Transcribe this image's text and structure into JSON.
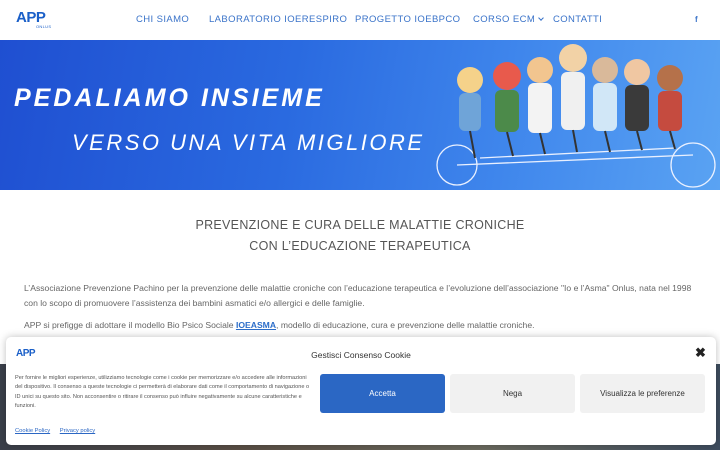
{
  "header": {
    "logo_text": "APP",
    "logo_sub": "ONLUS",
    "nav": [
      {
        "label": "CHI SIAMO"
      },
      {
        "label": "LABORATORIO IOERESPIRO"
      },
      {
        "label": "PROGETTO IOEBPCO"
      },
      {
        "label": "CORSO ECM"
      },
      {
        "label": "CONTATTI"
      }
    ],
    "social_icon": "facebook-icon",
    "social_glyph": "f"
  },
  "banner": {
    "line1": "PEDALIAMO INSIEME",
    "line2": "VERSO UNA VITA MIGLIORE"
  },
  "main": {
    "headline1": "PREVENZIONE E CURA DELLE MALATTIE CRONICHE",
    "headline2": "CON L’EDUCAZIONE TERAPEUTICA",
    "para1": "L’Associazione Prevenzione Pachino per la prevenzione delle malattie croniche con l’educazione terapeutica e l’evoluzione dell’associazione \"Io e l’Asma\" Onlus, nata nel 1998 con lo scopo di promuovere l’assistenza dei bambini asmatici e/o allergici e delle famiglie.",
    "para2_before": "APP si prefigge di adottare il modello Bio Psico Sociale ",
    "para2_link": "IOEASMA",
    "para2_after": ", modello di educazione, cura e prevenzione delle malattie croniche."
  },
  "cookie": {
    "title": "Gestisci Consenso Cookie",
    "close_glyph": "✖",
    "text": "Per fornire le migliori esperienze, utilizziamo tecnologie come i cookie per memorizzare e/o accedere alle informazioni del dispositivo. Il consenso a queste tecnologie ci permetterà di elaborare dati come il comportamento di navigazione o ID unici su questo sito. Non acconsentire o ritirare il consenso può influire negativamente su alcune caratteristiche e funzioni.",
    "accept_label": "Accetta",
    "deny_label": "Nega",
    "prefs_label": "Visualizza le preferenze",
    "link_cookie_policy": "Cookie Policy",
    "link_privacy_policy": "Privacy policy"
  },
  "colors": {
    "brand": "#1a5fc8",
    "nav": "#3a73c9",
    "accept_button": "#2b67c4"
  }
}
